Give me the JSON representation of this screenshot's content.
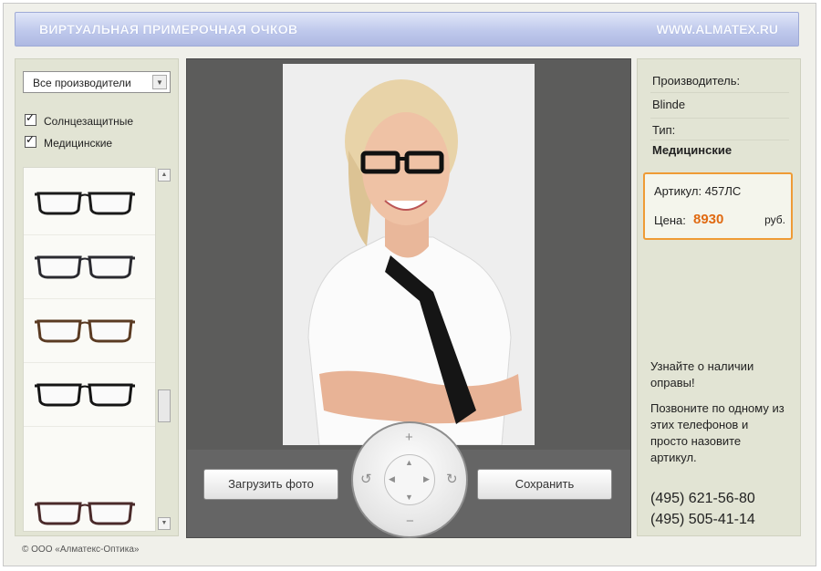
{
  "header": {
    "title": "ВИРТУАЛЬНАЯ ПРИМЕРОЧНАЯ ОЧКОВ",
    "site": "WWW.ALMATEX.RU"
  },
  "filters": {
    "manufacturer_select": "Все производители",
    "checkbox_sun": "Солнцезащитные",
    "checkbox_medical": "Медицинские"
  },
  "glasses_list": [
    {
      "color": "#1a1a1a"
    },
    {
      "color": "#2a2a30"
    },
    {
      "color": "#5a3a22"
    },
    {
      "color": "#141414"
    },
    {
      "color": "#4a2a2a"
    }
  ],
  "controls": {
    "upload_label": "Загрузить фото",
    "save_label": "Сохранить",
    "dial_up": "+",
    "dial_down": "−",
    "dial_rot_left": "↺",
    "dial_rot_right": "↻"
  },
  "product": {
    "manufacturer_label": "Производитель:",
    "manufacturer_value": "Blinde",
    "type_label": "Тип:",
    "type_value": "Медицинские",
    "article_label": "Артикул: 457ЛС",
    "price_label": "Цена:",
    "price_value": "8930",
    "currency": "руб."
  },
  "contact": {
    "text1": "Узнайте о наличии оправы!",
    "text2": "Позвоните по одному из этих телефонов и просто назовите артикул.",
    "phone1": "(495) 621-56-80",
    "phone2": "(495) 505-41-14"
  },
  "footer": {
    "copyright": "© ООО «Алматекс-Оптика»"
  },
  "colors": {
    "accent_orange": "#ef9b35",
    "price_orange": "#e06a12",
    "header_blue": "#bfc9ec",
    "panel_bg": "#e2e4d4",
    "center_dark": "#5c5c5b"
  }
}
